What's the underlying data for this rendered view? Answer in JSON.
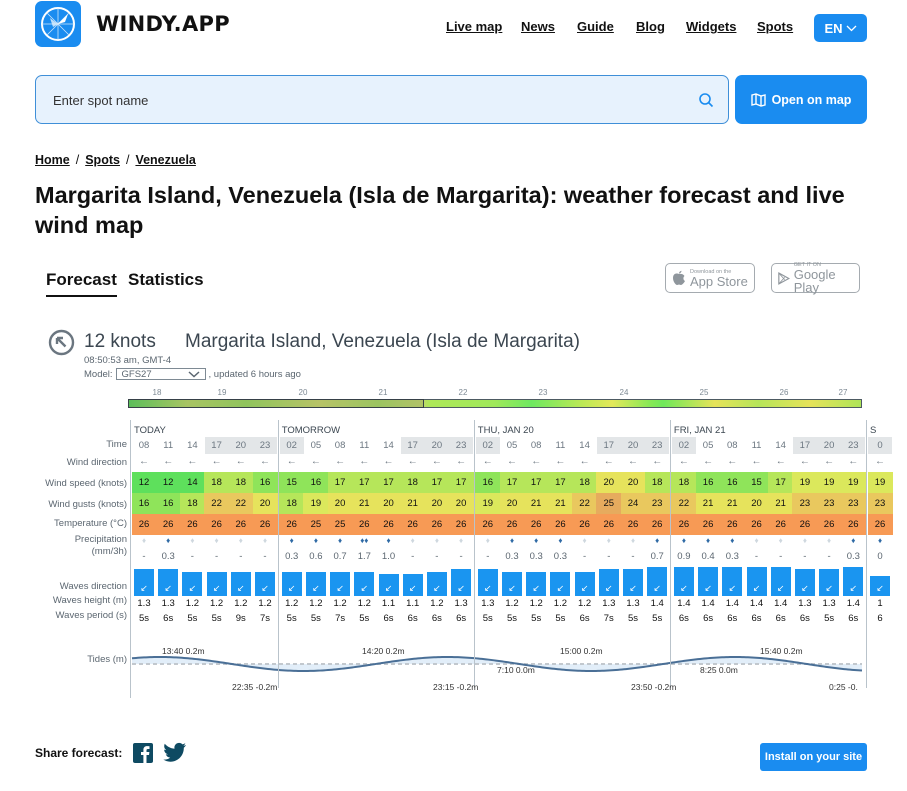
{
  "header": {
    "brand": "WINDY.APP",
    "logo_icon": "windrose-logo-icon",
    "nav": [
      "Live map",
      "News",
      "Guide",
      "Blog",
      "Widgets",
      "Spots"
    ],
    "language": "EN"
  },
  "search": {
    "placeholder": "Enter spot name",
    "value": "",
    "open_map_label": "Open on map"
  },
  "breadcrumb": [
    "Home",
    "Spots",
    "Venezuela"
  ],
  "page_title": "Margarita Island, Venezuela (Isla de Margarita): weather forecast and live wind map",
  "tabs": [
    {
      "label": "Forecast",
      "active": true
    },
    {
      "label": "Statistics",
      "active": false
    }
  ],
  "stores": {
    "app_store": {
      "small": "Download on the",
      "big": "App Store"
    },
    "google_play": {
      "small": "GET IT ON",
      "big": "Google Play"
    }
  },
  "widget": {
    "current_speed": "12 knots",
    "spot_name": "Margarita Island, Venezuela (Isla de Margarita)",
    "local_time": "08:50:53 am, GMT-4",
    "model_label": "Model:",
    "model_value": "GFS27",
    "updated": ", updated 6 hours ago",
    "timeline_days": [
      "18",
      "19",
      "20",
      "21",
      "22",
      "23",
      "24",
      "25",
      "26",
      "27"
    ]
  },
  "forecast": {
    "row_labels": {
      "time": "Time",
      "wind_direction": "Wind direction",
      "wind_speed": "Wind speed (knots)",
      "wind_gusts": "Wind gusts (knots)",
      "temperature": "Temperature (°C)",
      "precipitation": "Precipitation",
      "precipitation_unit": "(mm/3h)",
      "waves_direction": "Waves direction",
      "waves_height": "Waves height (m)",
      "waves_period": "Waves period (s)",
      "tides": "Tides (m)"
    },
    "days": [
      {
        "label": "TODAY",
        "start": 0
      },
      {
        "label": "TOMORROW",
        "start": 6
      },
      {
        "label": "THU, JAN 20",
        "start": 14
      },
      {
        "label": "FRI, JAN 21",
        "start": 22
      },
      {
        "label": "S",
        "start": 30
      }
    ],
    "times": [
      "08",
      "11",
      "14",
      "17",
      "20",
      "23",
      "02",
      "05",
      "08",
      "11",
      "14",
      "17",
      "20",
      "23",
      "02",
      "05",
      "08",
      "11",
      "14",
      "17",
      "20",
      "23",
      "02",
      "05",
      "08",
      "11",
      "14",
      "17",
      "20",
      "23",
      "0"
    ],
    "night": [
      false,
      false,
      false,
      true,
      true,
      true,
      true,
      false,
      false,
      false,
      false,
      true,
      true,
      true,
      true,
      false,
      false,
      false,
      false,
      true,
      true,
      true,
      true,
      false,
      false,
      false,
      false,
      true,
      true,
      true,
      true
    ],
    "wind_direction": [
      "←",
      "←",
      "←",
      "←",
      "←",
      "←",
      "←",
      "←",
      "←",
      "←",
      "←",
      "←",
      "←",
      "←",
      "←",
      "←",
      "←",
      "←",
      "←",
      "←",
      "←",
      "←",
      "←",
      "←",
      "←",
      "←",
      "←",
      "←",
      "←",
      "←",
      "←"
    ],
    "wind_speed": [
      12,
      12,
      14,
      18,
      18,
      16,
      15,
      16,
      17,
      17,
      17,
      18,
      17,
      17,
      16,
      17,
      17,
      17,
      18,
      20,
      20,
      18,
      18,
      16,
      16,
      15,
      17,
      19,
      19,
      19,
      19
    ],
    "wind_gusts": [
      16,
      16,
      18,
      22,
      22,
      20,
      18,
      19,
      20,
      21,
      20,
      21,
      20,
      20,
      19,
      20,
      21,
      21,
      22,
      25,
      24,
      23,
      22,
      21,
      21,
      20,
      21,
      23,
      23,
      23,
      23
    ],
    "temperature": [
      26,
      26,
      26,
      26,
      26,
      26,
      26,
      25,
      25,
      26,
      26,
      26,
      26,
      26,
      26,
      26,
      26,
      26,
      26,
      26,
      26,
      26,
      26,
      26,
      26,
      26,
      26,
      26,
      26,
      26,
      26
    ],
    "precip_drop": [
      "none",
      "light",
      "none",
      "none",
      "none",
      "none",
      "light",
      "light",
      "light",
      "moderate",
      "light",
      "none",
      "none",
      "none",
      "none",
      "light",
      "light",
      "light",
      "none",
      "none",
      "none",
      "light",
      "light",
      "light",
      "light",
      "none",
      "none",
      "none",
      "none",
      "light",
      "light"
    ],
    "precipitation": [
      "-",
      "0.3",
      "-",
      "-",
      "-",
      "-",
      "0.3",
      "0.6",
      "0.7",
      "1.7",
      "1.0",
      "-",
      "-",
      "-",
      "-",
      "0.3",
      "0.3",
      "0.3",
      "-",
      "-",
      "-",
      "0.7",
      "0.9",
      "0.4",
      "0.3",
      "-",
      "-",
      "-",
      "-",
      "0.3",
      "0"
    ],
    "waves_direction": [
      "↙",
      "↙",
      "↙",
      "↙",
      "↙",
      "↙",
      "↙",
      "↙",
      "↙",
      "↙",
      "↙",
      "↙",
      "↙",
      "↙",
      "↙",
      "↙",
      "↙",
      "↙",
      "↙",
      "↙",
      "↙",
      "↙",
      "↙",
      "↙",
      "↙",
      "↙",
      "↙",
      "↙",
      "↙",
      "↙",
      "↙"
    ],
    "waves_height": [
      "1.3",
      "1.3",
      "1.2",
      "1.2",
      "1.2",
      "1.2",
      "1.2",
      "1.2",
      "1.2",
      "1.2",
      "1.1",
      "1.1",
      "1.2",
      "1.3",
      "1.3",
      "1.2",
      "1.2",
      "1.2",
      "1.2",
      "1.3",
      "1.3",
      "1.4",
      "1.4",
      "1.4",
      "1.4",
      "1.4",
      "1.4",
      "1.3",
      "1.3",
      "1.4",
      "1"
    ],
    "waves_period": [
      "5s",
      "6s",
      "5s",
      "5s",
      "9s",
      "7s",
      "5s",
      "5s",
      "7s",
      "5s",
      "6s",
      "6s",
      "6s",
      "6s",
      "5s",
      "5s",
      "5s",
      "5s",
      "6s",
      "7s",
      "5s",
      "5s",
      "6s",
      "6s",
      "6s",
      "6s",
      "6s",
      "6s",
      "5s",
      "6s",
      "6"
    ],
    "tides": [
      {
        "label": "13:40 0.2m",
        "type": "high"
      },
      {
        "label": "22:35 -0.2m",
        "type": "low"
      },
      {
        "label": "14:20 0.2m",
        "type": "high"
      },
      {
        "label": "23:15 -0.2m",
        "type": "low"
      },
      {
        "label": "7:10 0.0m",
        "type": "mid"
      },
      {
        "label": "15:00 0.2m",
        "type": "high"
      },
      {
        "label": "23:50 -0.2m",
        "type": "low"
      },
      {
        "label": "8:25 0.0m",
        "type": "mid"
      },
      {
        "label": "15:40 0.2m",
        "type": "high"
      },
      {
        "label": "0:25 -0.",
        "type": "low"
      }
    ]
  },
  "footer": {
    "share_label": "Share forecast:",
    "install_label": "Install on your site"
  },
  "colors": {
    "accent": "#1a8cf0",
    "wave_bar": "#1a95f0",
    "temperature": "#f79a55"
  }
}
